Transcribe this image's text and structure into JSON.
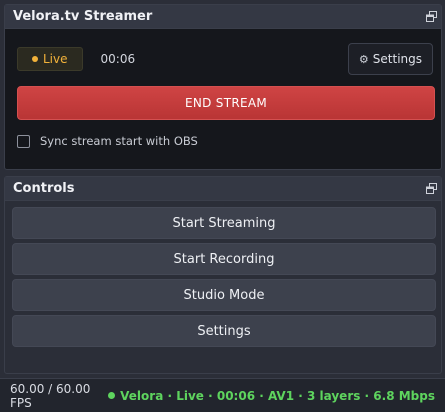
{
  "streamer_dock": {
    "title": "Velora.tv Streamer",
    "live_label": "Live",
    "timer": "00:06",
    "settings_label": "Settings",
    "settings_icon": "⚙",
    "end_stream_label": "END STREAM",
    "sync_label": "Sync stream start with OBS",
    "sync_checked": false
  },
  "controls_dock": {
    "title": "Controls",
    "buttons": [
      {
        "label": "Start Streaming"
      },
      {
        "label": "Start Recording"
      },
      {
        "label": "Studio Mode"
      },
      {
        "label": "Settings"
      }
    ]
  },
  "statusbar": {
    "fps": "60.00 / 60.00 FPS",
    "stream_info": "Velora · Live · 00:06 · AV1 · 3 layers · 6.8 Mbps"
  },
  "colors": {
    "live_accent": "#f2b23a",
    "end_stream_red": "#c43d3d",
    "status_green": "#5ed45e"
  }
}
